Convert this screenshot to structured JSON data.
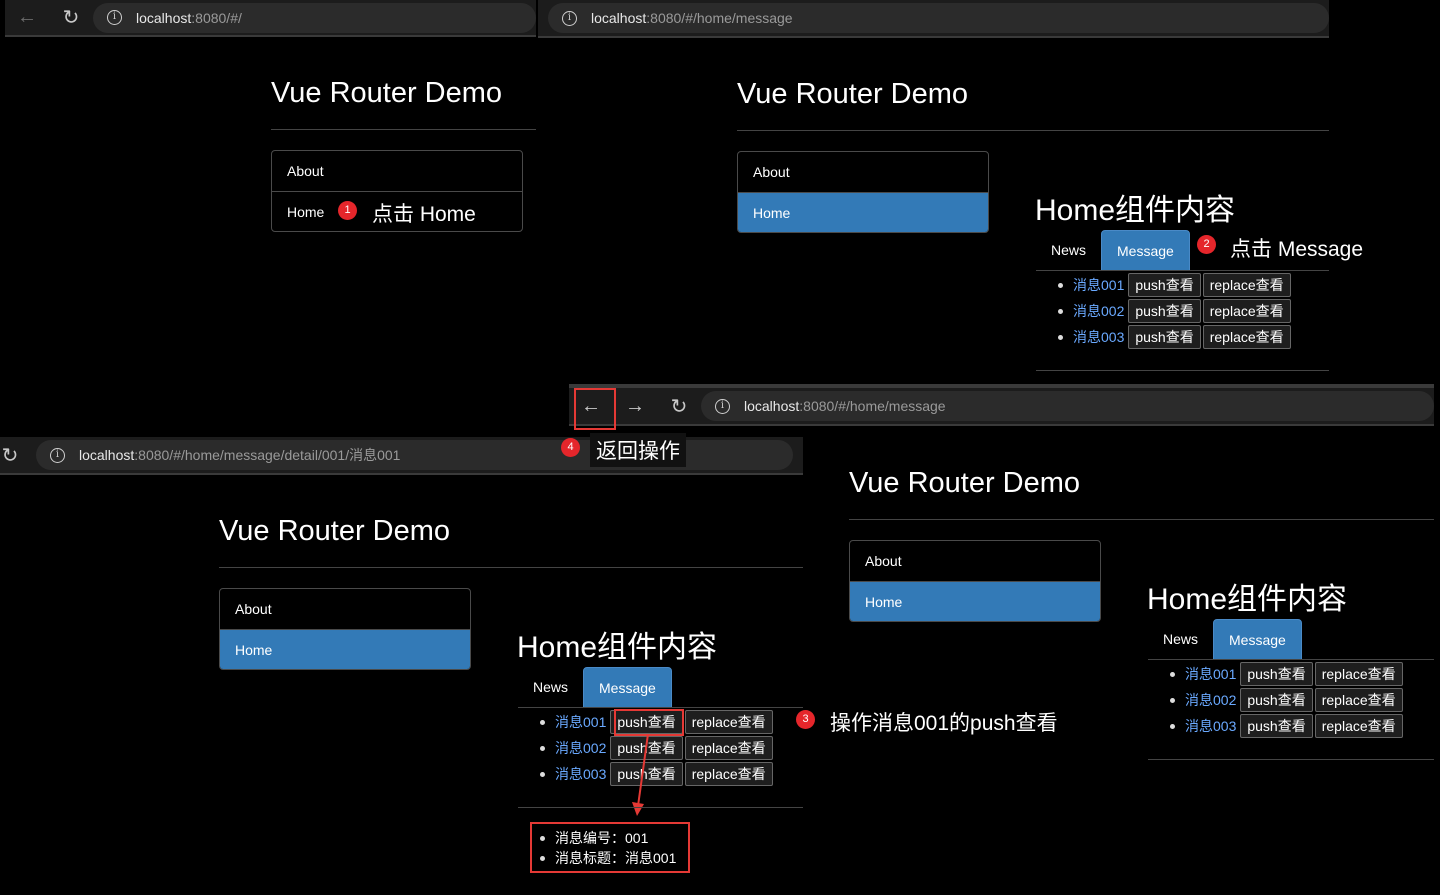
{
  "browser1": {
    "host": "localhost",
    "rest": ":8080/#/"
  },
  "browser2": {
    "host": "localhost",
    "rest": ":8080/#/home/message"
  },
  "browser3": {
    "host": "localhost",
    "rest": ":8080/#/home/message"
  },
  "browser4": {
    "host": "localhost",
    "rest": ":8080/#/home/message/detail/001/消息001"
  },
  "app": {
    "title": "Vue Router Demo",
    "nav": [
      "About",
      "Home"
    ],
    "home_heading": "Home组件内容",
    "tabs": [
      "News",
      "Message"
    ],
    "messages": [
      {
        "link": "消息001",
        "push": "push查看",
        "replace": "replace查看"
      },
      {
        "link": "消息002",
        "push": "push查看",
        "replace": "replace查看"
      },
      {
        "link": "消息003",
        "push": "push查看",
        "replace": "replace查看"
      }
    ],
    "detail": [
      "消息编号：001",
      "消息标题：消息001"
    ]
  },
  "annotations": {
    "step1": {
      "num": "1",
      "text": "点击 Home"
    },
    "step2": {
      "num": "2",
      "text": "点击 Message"
    },
    "step3": {
      "num": "3",
      "text": "操作消息001的push查看"
    },
    "step4": {
      "num": "4",
      "text": "返回操作"
    }
  },
  "icons": {
    "back": "arrow-left-icon",
    "forward": "arrow-right-icon",
    "reload": "reload-icon",
    "info": "info-icon"
  },
  "colors": {
    "active": "#337ab7",
    "badge": "#e5262b",
    "highlight": "#e53935",
    "link": "#6aa9ff"
  }
}
